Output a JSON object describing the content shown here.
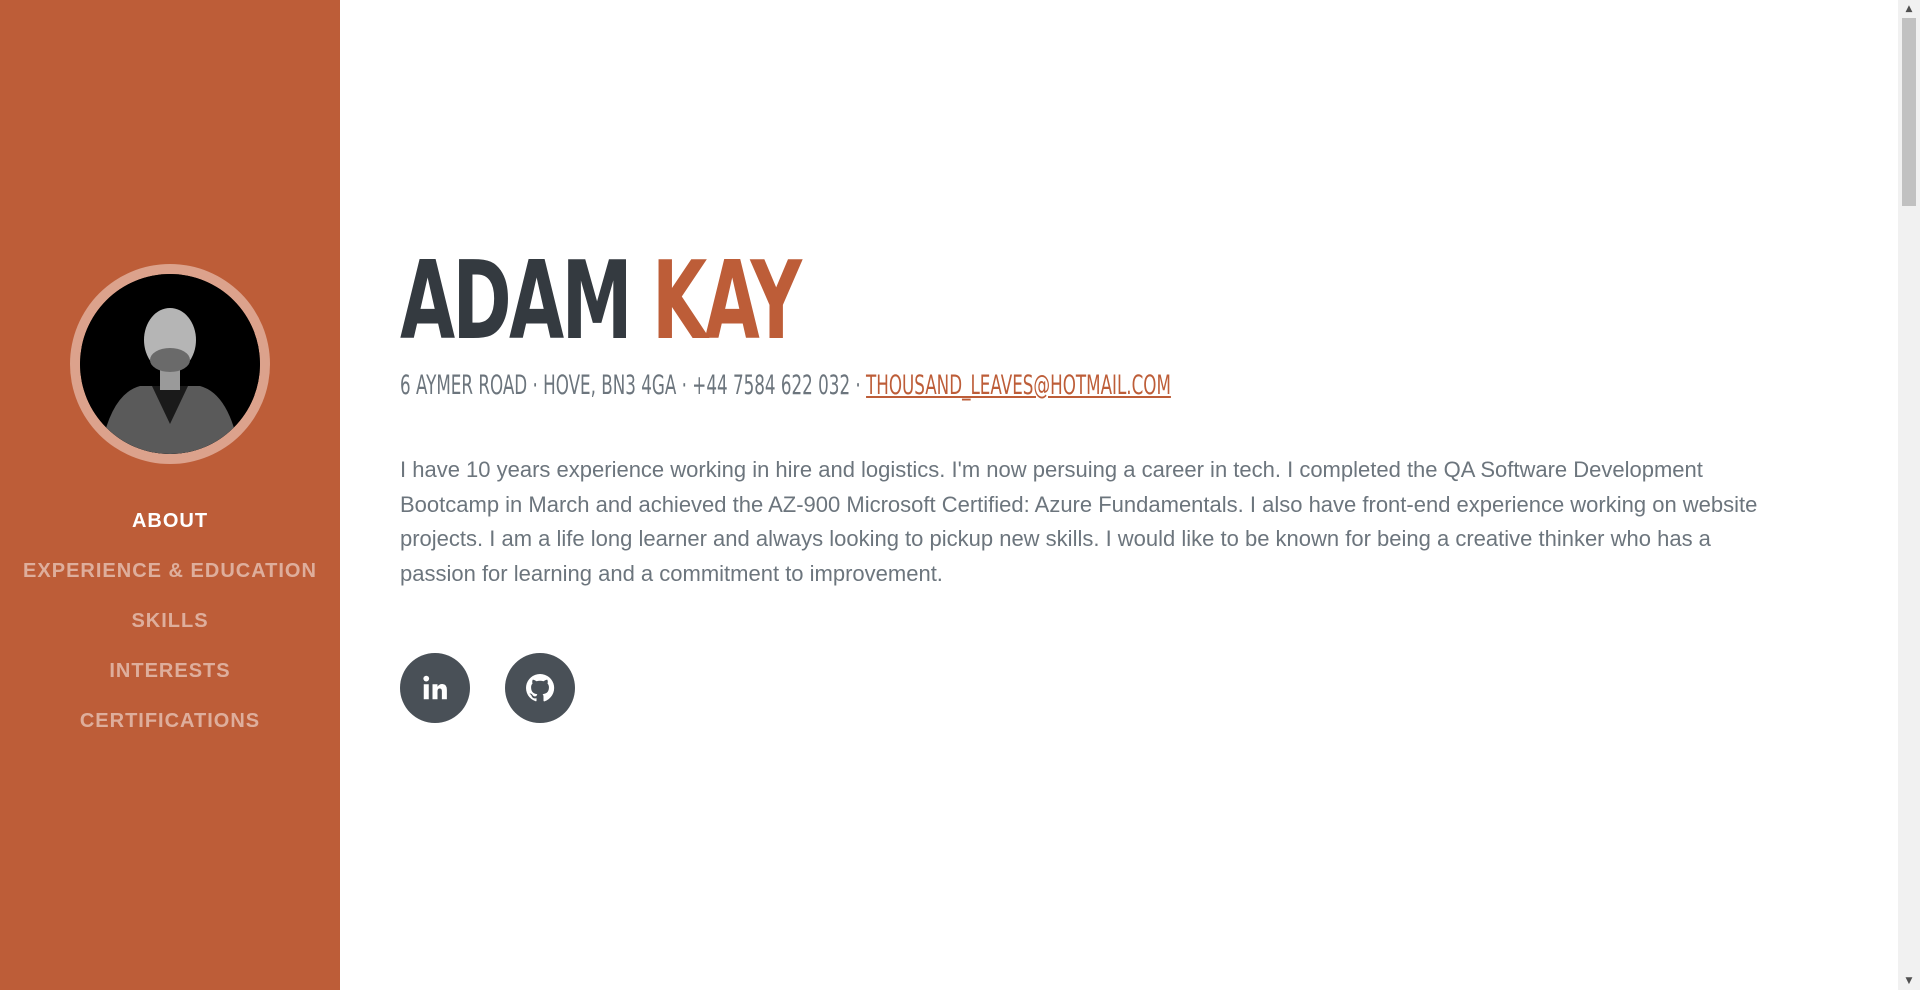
{
  "sidebar": {
    "avatar_alt": "Profile photo",
    "nav": [
      {
        "label": "About",
        "active": true
      },
      {
        "label": "Experience & Education",
        "active": false
      },
      {
        "label": "Skills",
        "active": false
      },
      {
        "label": "Interests",
        "active": false
      },
      {
        "label": "Certifications",
        "active": false
      }
    ]
  },
  "about": {
    "first_name": "ADAM",
    "last_name": "KAY",
    "address": "6 Aymer Road · Hove, BN3 4GA · +44 7584 622 032 · ",
    "email": "thousand_leaves@hotmail.com",
    "bio": "I have 10 years experience working in hire and logistics. I'm now persuing a career in tech. I completed the QA Software Development Bootcamp in March and achieved the AZ-900 Microsoft Certified: Azure Fundamentals. I also have front-end experience working on website projects. I am a life long learner and always looking to pickup new skills. I would like to be known for being a creative thinker who has a passion for learning and a commitment to improvement."
  },
  "social": [
    {
      "icon": "linkedin-icon"
    },
    {
      "icon": "github-icon"
    }
  ],
  "colors": {
    "primary": "#bd5d38",
    "dark": "#343a40",
    "muted": "#6c757d",
    "social_bg": "#495057"
  }
}
